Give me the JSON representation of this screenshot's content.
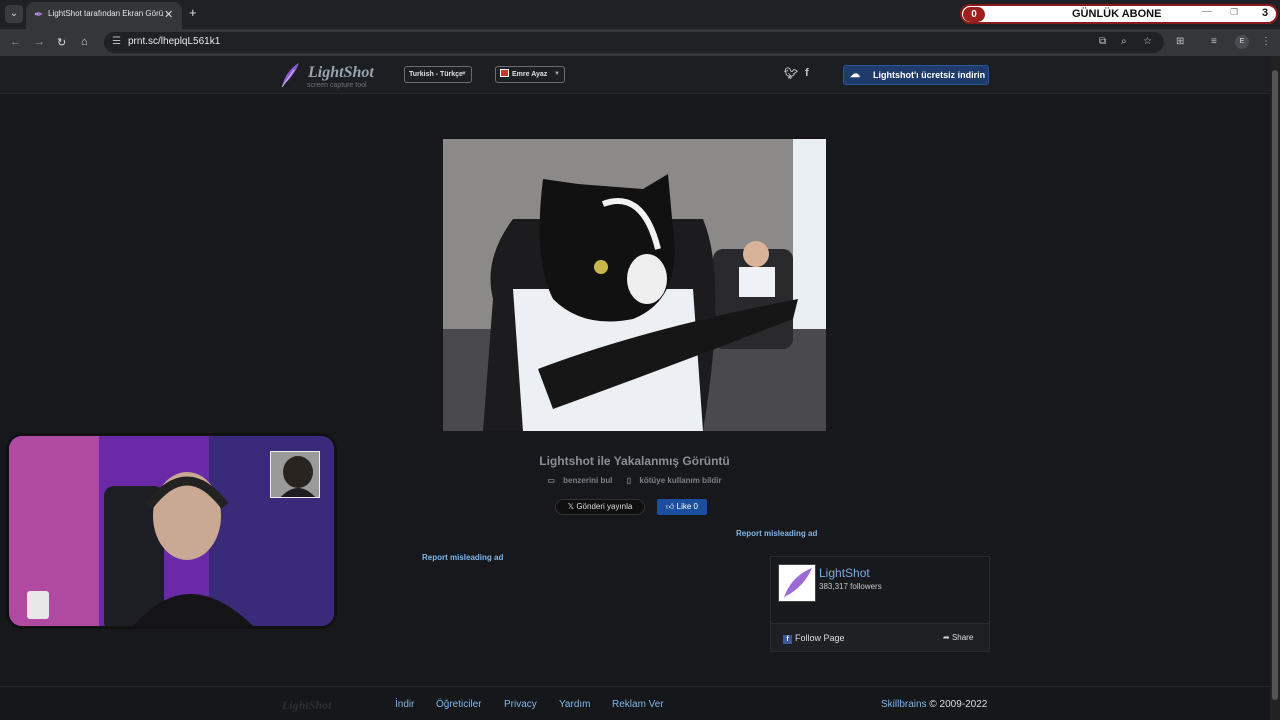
{
  "browser": {
    "tab_title": "LightShot tarafından Ekran Görü",
    "url": "prnt.sc/lheplqL561k1"
  },
  "overlay": {
    "left_count": "0",
    "label": "GÜNLÜK ABONE",
    "right_count": "3"
  },
  "site": {
    "logo_name": "LightShot",
    "logo_tagline": "screen capture tool",
    "language_select": "Turkish - Türkçe",
    "user_select": "Emre Ayaz",
    "download_button": "Lightshot'ı ücretsiz indirin"
  },
  "screenshot": {
    "caption": "Lightshot ile Yakalanmış Görüntü",
    "find_similar": "benzerini bul",
    "report_abuse": "kötüye kullanım bildir",
    "tweet_button": "Gönderi yayınla",
    "like_button": "Like 0"
  },
  "ads": {
    "report_right": "Report misleading ad",
    "report_left": "Report misleading ad"
  },
  "facebook": {
    "page_name": "LightShot",
    "followers": "383,317 followers",
    "follow_label": "Follow Page",
    "share_label": "Share"
  },
  "footer": {
    "logo": "LightShot",
    "links": [
      "İndir",
      "Öğreticiler",
      "Privacy",
      "Yardım",
      "Reklam Ver"
    ],
    "brand": "Skillbrains",
    "copyright": "© 2009-2022"
  },
  "colors": {
    "page_bg": "#16181c",
    "link": "#7fb6e8",
    "accent_button": "#1f3b6b",
    "overlay_red": "#9d1f1f"
  }
}
